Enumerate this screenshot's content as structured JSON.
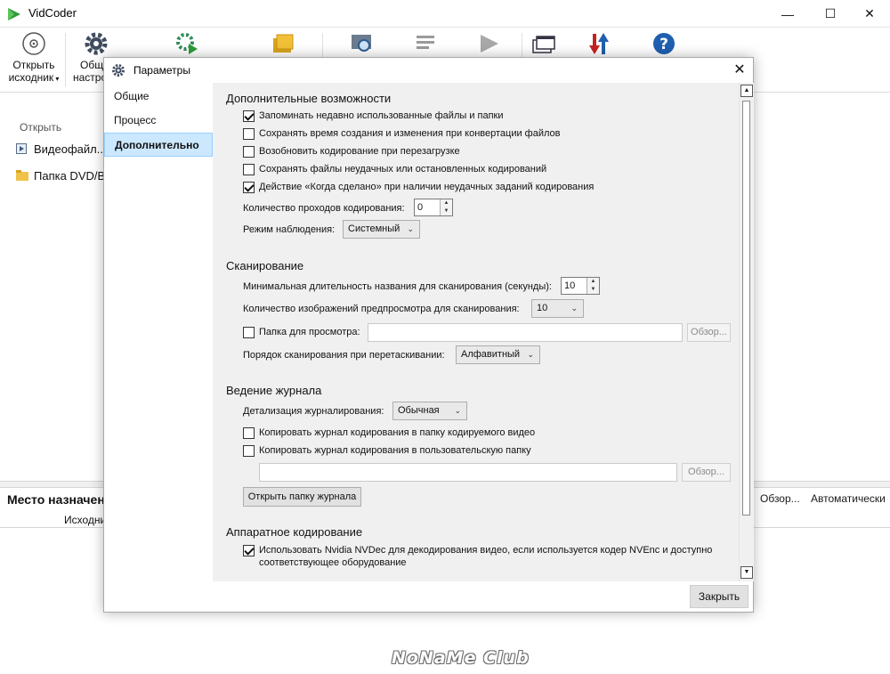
{
  "app": {
    "title": "VidCoder"
  },
  "toolbar": {
    "open_source_line1": "Открыть",
    "open_source_line2": "исходник",
    "general_settings_line1": "Общ",
    "general_settings_line2": "настро"
  },
  "left_pane": {
    "open_label": "Открыть",
    "video_file": "Видеофайл...",
    "dvd_folder": "Папка DVD/B"
  },
  "destination": {
    "title": "Место назначен",
    "sub": "Исходни",
    "browse": "Обзор...",
    "auto": "Автоматически"
  },
  "watermark": "NoNaMe Club",
  "dialog": {
    "title": "Параметры",
    "close_button": "Закрыть",
    "nav": [
      "Общие",
      "Процесс",
      "Дополнительно"
    ],
    "advanced": {
      "title": "Дополнительные возможности",
      "remember_recent": "Запоминать недавно использованные файлы и папки",
      "keep_timestamps": "Сохранять время создания и изменения при конвертации файлов",
      "resume_on_restart": "Возобновить кодирование при перезагрузке",
      "keep_failed": "Сохранять файлы неудачных или остановленных кодирований",
      "when_done_action": "Действие «Когда сделано» при наличии неудачных заданий кодирования",
      "encode_passes_label": "Количество проходов кодирования:",
      "encode_passes_value": "0",
      "watch_mode_label": "Режим наблюдения:",
      "watch_mode_value": "Системный"
    },
    "scan": {
      "title": "Сканирование",
      "min_title_label": "Минимальная длительность названия для сканирования (секунды):",
      "min_title_value": "10",
      "preview_count_label": "Количество изображений предпросмотра для сканирования:",
      "preview_count_value": "10",
      "watch_folder_label": "Папка для просмотра:",
      "browse": "Обзор...",
      "drag_order_label": "Порядок сканирования при перетаскивании:",
      "drag_order_value": "Алфавитный"
    },
    "logging": {
      "title": "Ведение журнала",
      "verbosity_label": "Детализация журналирования:",
      "verbosity_value": "Обычная",
      "copy_to_video": "Копировать журнал кодирования в папку кодируемого видео",
      "copy_to_custom": "Копировать журнал кодирования в пользовательскую папку",
      "browse": "Обзор...",
      "open_log_folder": "Открыть папку журнала"
    },
    "hardware": {
      "title": "Аппаратное кодирование",
      "nvdec_line1": "Использовать Nvidia NVDec для декодирования видео, если используется кодер NVEnc и доступно",
      "nvdec_line2": "соответствующее оборудование"
    }
  }
}
